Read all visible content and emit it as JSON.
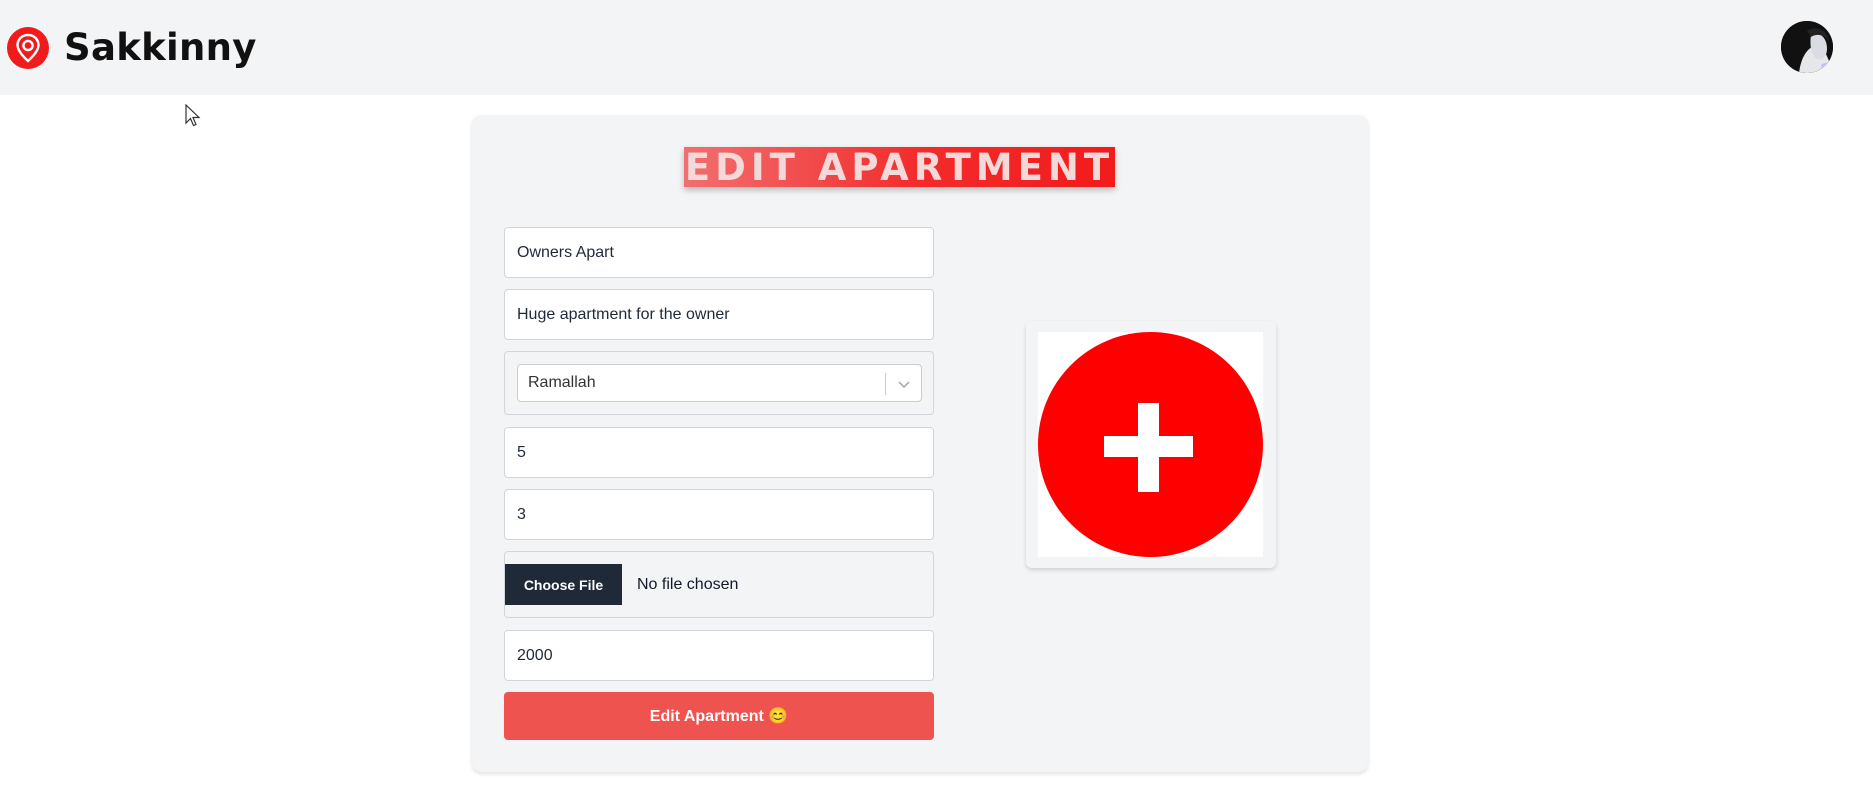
{
  "header": {
    "brand": "Sakkinny"
  },
  "colors": {
    "accent": "#ef5350",
    "brand_red": "#f21b1b",
    "header_bg": "#f3f4f6",
    "dark_button": "#1f2937"
  },
  "icons": {
    "logo": "location-pin-icon",
    "avatar": "user-avatar",
    "select": "chevron-down-icon",
    "upload": "add-image-plus-icon"
  },
  "form": {
    "title": "EDIT APARTMENT",
    "name_value": "Owners Apart",
    "description_value": "Huge apartment for the owner",
    "city_selected": "Ramallah",
    "rooms_value": "5",
    "bathrooms_value": "3",
    "file_button_label": "Choose File",
    "file_status": "No file chosen",
    "price_value": "2000",
    "submit_label": "Edit Apartment 😊"
  }
}
